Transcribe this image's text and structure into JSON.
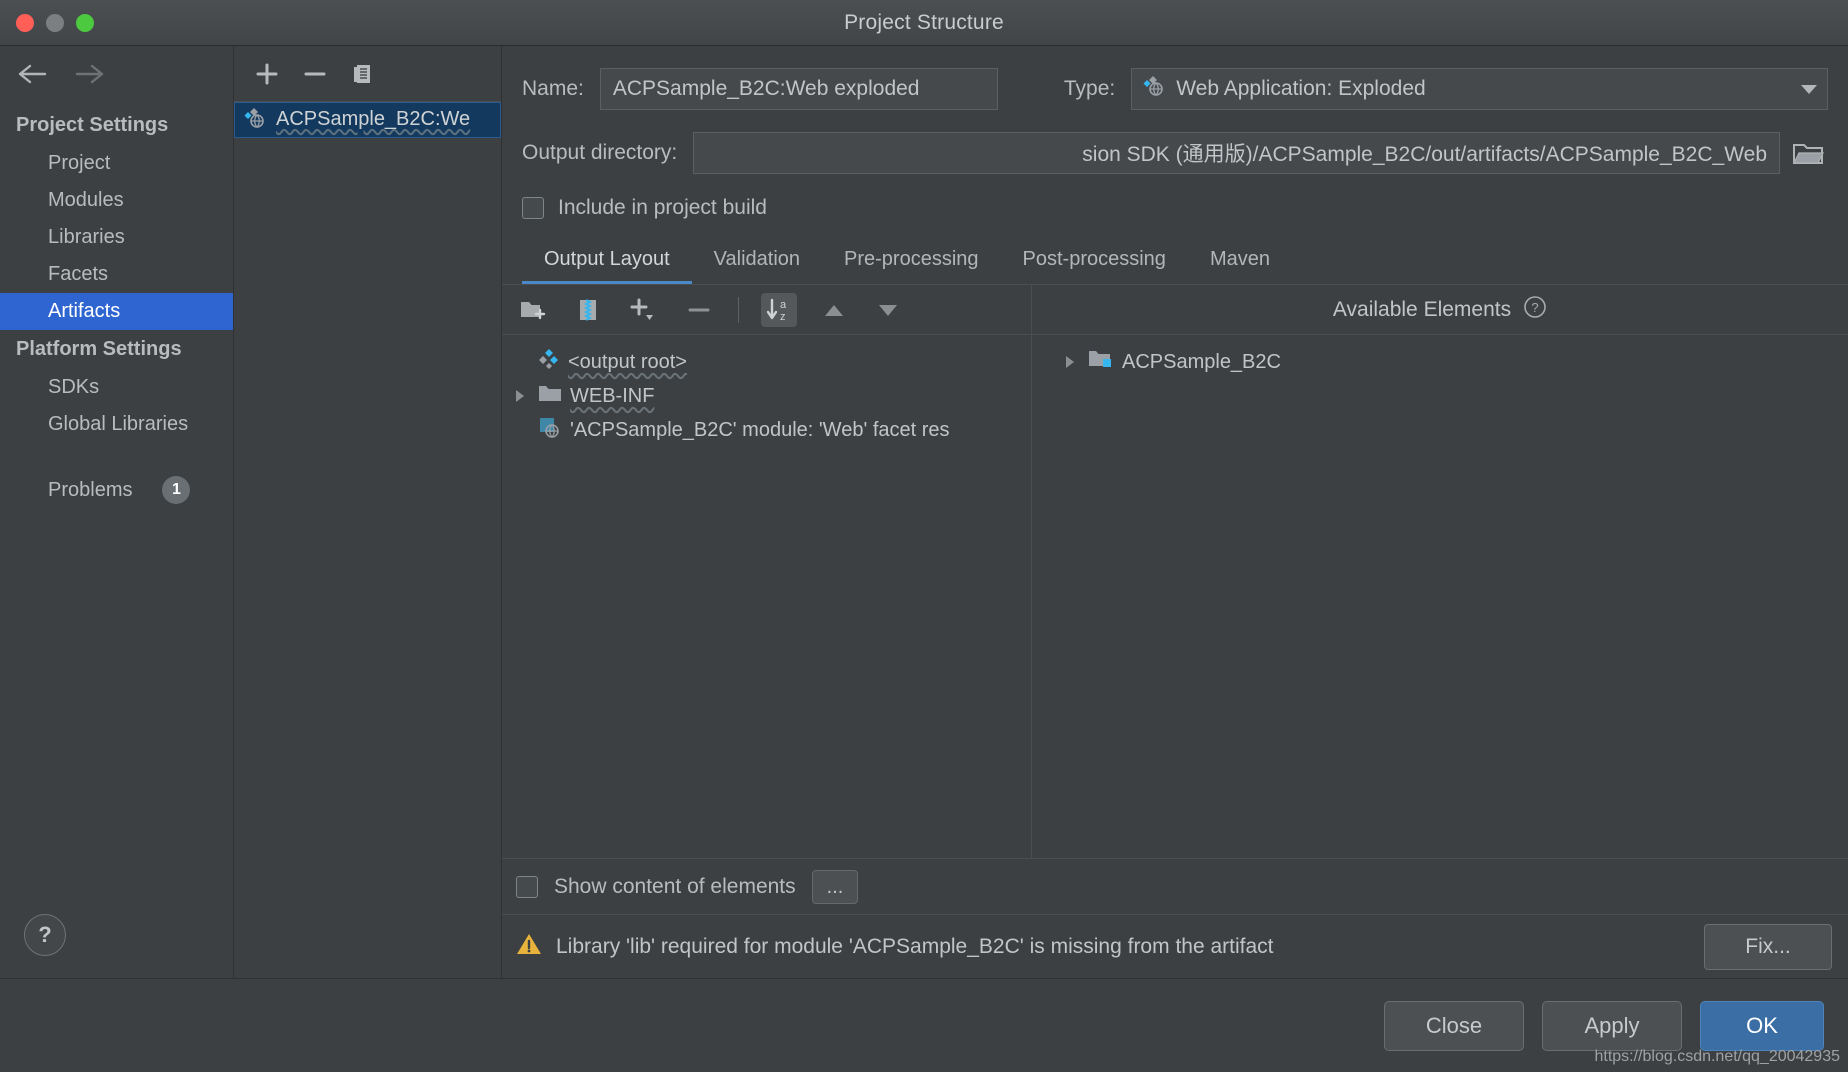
{
  "window": {
    "title": "Project Structure",
    "traffic_lights": [
      "close-red",
      "minimize-gray",
      "maximize-green"
    ]
  },
  "sidebar": {
    "back_icon": "arrow-left-icon",
    "forward_icon": "arrow-right-icon",
    "groups": [
      {
        "title": "Project Settings",
        "items": [
          {
            "label": "Project",
            "selected": false
          },
          {
            "label": "Modules",
            "selected": false
          },
          {
            "label": "Libraries",
            "selected": false
          },
          {
            "label": "Facets",
            "selected": false
          },
          {
            "label": "Artifacts",
            "selected": true
          }
        ]
      },
      {
        "title": "Platform Settings",
        "items": [
          {
            "label": "SDKs",
            "selected": false
          },
          {
            "label": "Global Libraries",
            "selected": false
          }
        ]
      }
    ],
    "problems": {
      "label": "Problems",
      "count": "1"
    },
    "help_label": "?",
    "selected_accent": "#2f65d0"
  },
  "artifact_panel": {
    "toolbar": [
      {
        "icon": "plus-icon",
        "label": "+"
      },
      {
        "icon": "minus-icon",
        "label": "−"
      },
      {
        "icon": "copy-icon",
        "label": "copy"
      }
    ],
    "items": [
      {
        "label": "ACPSample_B2C:We",
        "icon": "artifact-web-icon",
        "selected": true
      }
    ]
  },
  "detail": {
    "name_label": "Name:",
    "name_value": "ACPSample_B2C:Web exploded",
    "type_label": "Type:",
    "type_value": "Web Application: Exploded",
    "type_icon": "artifact-web-icon",
    "output_dir_label": "Output directory:",
    "output_dir_value": "sion SDK (通用版)/ACPSample_B2C/out/artifacts/ACPSample_B2C_Web",
    "browse_icon": "folder-browse-icon",
    "include_in_build": {
      "label": "Include in project build",
      "checked": false
    },
    "tabs": [
      {
        "label": "Output Layout",
        "active": true
      },
      {
        "label": "Validation",
        "active": false
      },
      {
        "label": "Pre-processing",
        "active": false
      },
      {
        "label": "Post-processing",
        "active": false
      },
      {
        "label": "Maven",
        "active": false
      }
    ],
    "layout_toolbar": [
      {
        "icon": "add-directory-icon"
      },
      {
        "icon": "add-archive-icon"
      },
      {
        "icon": "add-dropdown-icon"
      },
      {
        "icon": "remove-icon"
      },
      {
        "icon": "sort-az-icon",
        "active": true
      },
      {
        "icon": "move-up-icon"
      },
      {
        "icon": "move-down-icon"
      }
    ],
    "output_tree": [
      {
        "label": "<output root>",
        "icon": "output-root-icon",
        "twisty": false,
        "squiggle": true,
        "indent": 0
      },
      {
        "label": "WEB-INF",
        "icon": "folder-icon",
        "twisty": true,
        "squiggle": true,
        "indent": 0
      },
      {
        "label": "'ACPSample_B2C' module: 'Web' facet res",
        "icon": "web-facet-icon",
        "twisty": false,
        "squiggle": false,
        "indent": 1
      }
    ],
    "available_elements": {
      "title": "Available Elements",
      "help_icon": "question-circle-icon",
      "tree": [
        {
          "label": "ACPSample_B2C",
          "icon": "module-folder-icon",
          "twisty": true
        }
      ]
    },
    "show_content": {
      "label": "Show content of elements",
      "checked": false
    },
    "ellipsis_button": "...",
    "warning": {
      "icon": "warning-triangle-icon",
      "text": "Library 'lib' required for module 'ACPSample_B2C' is missing from the artifact",
      "fix_label": "Fix..."
    }
  },
  "footer": {
    "buttons": [
      {
        "label": "Close",
        "primary": false
      },
      {
        "label": "Apply",
        "primary": false
      },
      {
        "label": "OK",
        "primary": true
      }
    ],
    "watermark": "https://blog.csdn.net/qq_20042935",
    "primary_color": "#3a6ea5"
  }
}
